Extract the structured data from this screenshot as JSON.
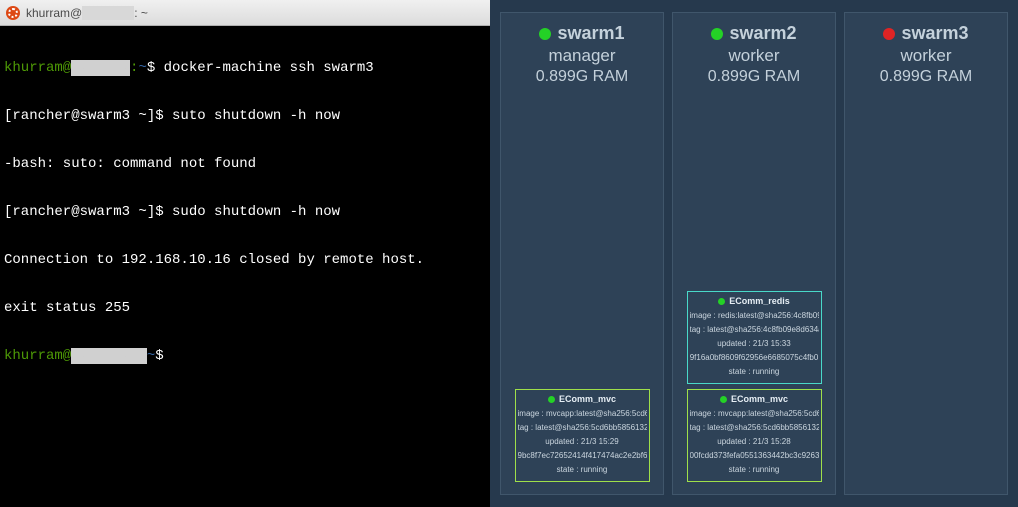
{
  "titlebar": {
    "prefix": "khurram@",
    "suffix": ": ~"
  },
  "terminal": {
    "l1_user": "khurram@",
    "l1_host": ":",
    "l1_path": "~",
    "l1_cmd": "$ docker-machine ssh swarm3",
    "l2_prompt": "[rancher@swarm3 ~]$ ",
    "l2_cmd": "suto shutdown -h now",
    "l3": "-bash: suto: command not found",
    "l4_prompt": "[rancher@swarm3 ~]$ ",
    "l4_cmd": "sudo shutdown -h now",
    "l5": "Connection to 192.168.10.16 closed by remote host.",
    "l6": "exit status 255",
    "l7_user": "khurram@",
    "l7_path": "~",
    "l7_tail": "$"
  },
  "nodes": [
    {
      "name": "swarm1",
      "role": "manager",
      "ram": "0.899G RAM",
      "status": "green",
      "tasks": [
        {
          "kind": "mvc",
          "title": "EComm_mvc",
          "image": "image : mvcapp:latest@sha256:5cd6",
          "tag": "tag : latest@sha256:5cd6bb5856132",
          "updated": "updated : 21/3 15:29",
          "hash": "9bc8f7ec72652414f417474ac2e2bf6",
          "state": "state : running"
        }
      ]
    },
    {
      "name": "swarm2",
      "role": "worker",
      "ram": "0.899G RAM",
      "status": "green",
      "tasks": [
        {
          "kind": "redis",
          "title": "EComm_redis",
          "image": "image : redis:latest@sha256:4c8fb09",
          "tag": "tag : latest@sha256:4c8fb09e8d634a",
          "updated": "updated : 21/3 15:33",
          "hash": "9f16a0bf8609f62956e6685075c4fb0",
          "state": "state : running"
        },
        {
          "kind": "mvc",
          "title": "EComm_mvc",
          "image": "image : mvcapp:latest@sha256:5cd6",
          "tag": "tag : latest@sha256:5cd6bb5856132",
          "updated": "updated : 21/3 15:28",
          "hash": "00fcdd373fefa0551363442bc3c9263",
          "state": "state : running"
        }
      ]
    },
    {
      "name": "swarm3",
      "role": "worker",
      "ram": "0.899G RAM",
      "status": "red",
      "tasks": []
    }
  ]
}
